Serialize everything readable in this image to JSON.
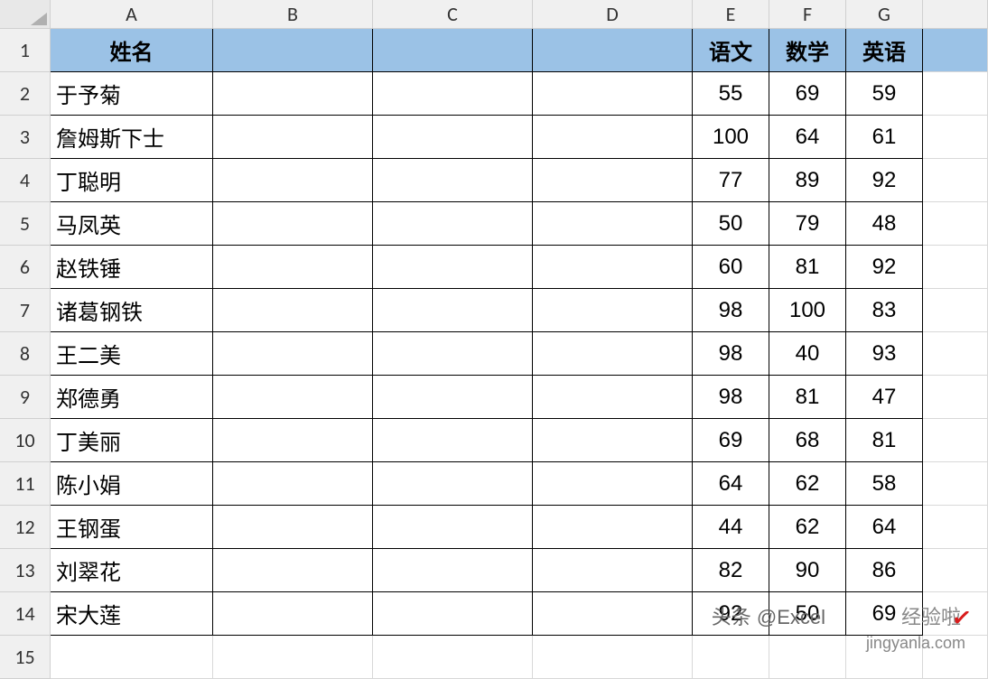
{
  "columns": [
    "A",
    "B",
    "C",
    "D",
    "E",
    "F",
    "G"
  ],
  "rowNumbers": [
    "1",
    "2",
    "3",
    "4",
    "5",
    "6",
    "7",
    "8",
    "9",
    "10",
    "11",
    "12",
    "13",
    "14",
    "15"
  ],
  "headers": {
    "A": "姓名",
    "B": "",
    "C": "",
    "D": "",
    "E": "语文",
    "F": "数学",
    "G": "英语"
  },
  "rows": [
    {
      "A": "于予菊",
      "B": "",
      "C": "",
      "D": "",
      "E": "55",
      "F": "69",
      "G": "59"
    },
    {
      "A": "詹姆斯下士",
      "B": "",
      "C": "",
      "D": "",
      "E": "100",
      "F": "64",
      "G": "61"
    },
    {
      "A": "丁聪明",
      "B": "",
      "C": "",
      "D": "",
      "E": "77",
      "F": "89",
      "G": "92"
    },
    {
      "A": "马凤英",
      "B": "",
      "C": "",
      "D": "",
      "E": "50",
      "F": "79",
      "G": "48"
    },
    {
      "A": "赵铁锤",
      "B": "",
      "C": "",
      "D": "",
      "E": "60",
      "F": "81",
      "G": "92"
    },
    {
      "A": "诸葛钢铁",
      "B": "",
      "C": "",
      "D": "",
      "E": "98",
      "F": "100",
      "G": "83"
    },
    {
      "A": "王二美",
      "B": "",
      "C": "",
      "D": "",
      "E": "98",
      "F": "40",
      "G": "93"
    },
    {
      "A": "郑德勇",
      "B": "",
      "C": "",
      "D": "",
      "E": "98",
      "F": "81",
      "G": "47"
    },
    {
      "A": "丁美丽",
      "B": "",
      "C": "",
      "D": "",
      "E": "69",
      "F": "68",
      "G": "81"
    },
    {
      "A": "陈小娟",
      "B": "",
      "C": "",
      "D": "",
      "E": "64",
      "F": "62",
      "G": "58"
    },
    {
      "A": "王钢蛋",
      "B": "",
      "C": "",
      "D": "",
      "E": "44",
      "F": "62",
      "G": "64"
    },
    {
      "A": "刘翠花",
      "B": "",
      "C": "",
      "D": "",
      "E": "82",
      "F": "90",
      "G": "86"
    },
    {
      "A": "宋大莲",
      "B": "",
      "C": "",
      "D": "",
      "E": "92",
      "F": "50",
      "G": "69"
    }
  ],
  "watermark": {
    "text1": "头条 @Excel",
    "text2": "jingyanla.com",
    "text3": "经验啦",
    "mark": "✓"
  }
}
